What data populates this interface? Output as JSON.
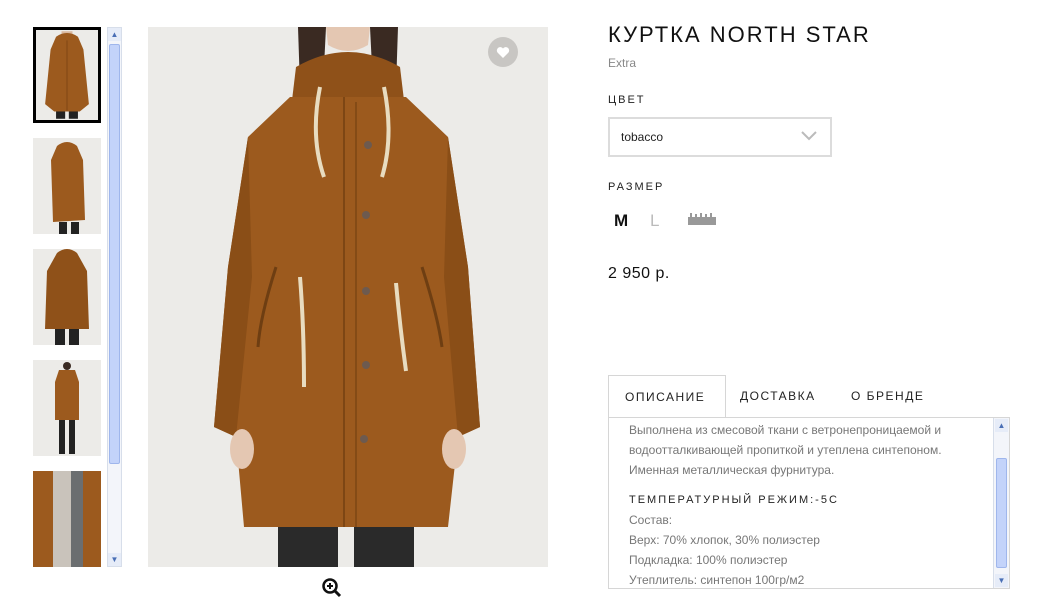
{
  "product": {
    "title": "КУРТКА NORTH STAR",
    "brand": "Extra",
    "price": "2 950 р."
  },
  "color": {
    "label": "ЦВЕТ",
    "selected": "tobacco"
  },
  "size": {
    "label": "РАЗМЕР",
    "options": [
      "M",
      "L"
    ],
    "selected": "M",
    "size_chart_icon": "ruler-icon"
  },
  "gallery": {
    "thumbnail_count": 5,
    "selected_index": 0
  },
  "icons": {
    "favorite": "heart-icon",
    "zoom": "zoom-in-icon",
    "dropdown": "chevron-down-icon"
  },
  "tabs": [
    {
      "label": "ОПИСАНИЕ",
      "active": true
    },
    {
      "label": "ДОСТАВКА",
      "active": false
    },
    {
      "label": "О БРЕНДЕ",
      "active": false
    }
  ],
  "description": {
    "paragraph": "Выполнена из смесовой ткани с ветронепроницаемой и водоотталкивающей пропиткой и утеплена синтепоном. Именная металлическая фурнитура.",
    "temperature": "ТЕМПЕРАТУРНЫЙ РЕЖИМ:-5С",
    "composition_label": "Состав:",
    "lines": [
      "Верх: 70% хлопок, 30% полиэстер",
      "Подкладка: 100% полиэстер",
      "Утеплитель: синтепон 100гр/м2"
    ]
  },
  "colors": {
    "jacket": "#9c5a1e",
    "jacket_shadow": "#7d4614",
    "background": "#ecebe8",
    "selected_border": "#000000"
  }
}
